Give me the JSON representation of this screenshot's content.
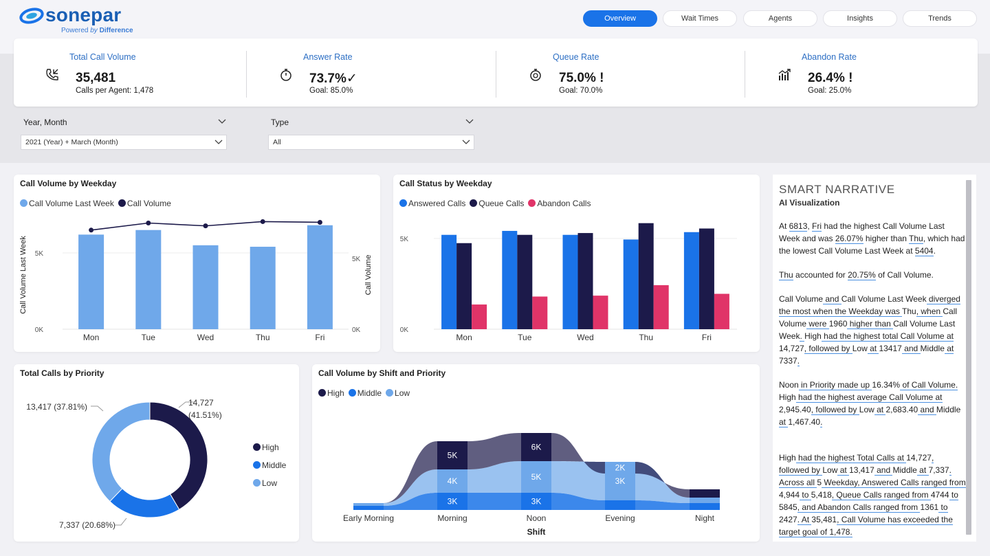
{
  "brand": {
    "name": "sonepar",
    "tagline_prefix": "Powered",
    "tagline_by": "by",
    "tagline_suffix": "Difference"
  },
  "nav": [
    "Overview",
    "Wait Times",
    "Agents",
    "Insights",
    "Trends"
  ],
  "kpis": [
    {
      "title": "Total Call Volume",
      "value": "35,481",
      "sub": "Calls per Agent: 1,478",
      "icon": "phone-incoming-icon"
    },
    {
      "title": "Answer Rate",
      "value": "73.7%✓",
      "sub": "Goal: 85.0%",
      "icon": "stopwatch-icon"
    },
    {
      "title": "Queue Rate",
      "value": "75.0% !",
      "sub": "Goal: 70.0%",
      "icon": "timer-icon"
    },
    {
      "title": "Abandon Rate",
      "value": "26.4% !",
      "sub": "Goal: 25.0%",
      "icon": "growth-chart-icon"
    }
  ],
  "filters": {
    "year_month": {
      "label": "Year, Month",
      "value": "2021 (Year) + March (Month)"
    },
    "type": {
      "label": "Type",
      "value": "All"
    }
  },
  "chart_titles": {
    "weekday": "Call Volume by Weekday",
    "status": "Call Status by Weekday",
    "priority": "Total Calls by Priority",
    "shift": "Call Volume by Shift and Priority"
  },
  "chart_data": [
    {
      "type": "bar",
      "title": "Call Volume by Weekday",
      "categories": [
        "Mon",
        "Tue",
        "Wed",
        "Thu",
        "Fri"
      ],
      "series": [
        {
          "name": "Call Volume Last Week",
          "kind": "bar",
          "values": [
            6200,
            6500,
            5500,
            5404,
            6813
          ]
        },
        {
          "name": "Call Volume",
          "kind": "line",
          "values": [
            7000,
            7500,
            7300,
            7600,
            7550
          ]
        }
      ],
      "ylabel": "Call Volume Last Week",
      "y2label": "Call Volume",
      "yticks": [
        "0K",
        "5K"
      ],
      "y2ticks": [
        "0K",
        "5K"
      ],
      "colors": [
        "#6fa8ea",
        "#1c1a4a"
      ]
    },
    {
      "type": "bar",
      "title": "Call Status by Weekday",
      "categories": [
        "Mon",
        "Tue",
        "Wed",
        "Thu",
        "Fri"
      ],
      "series": [
        {
          "name": "Answered Calls",
          "values": [
            5200,
            5418,
            5200,
            4944,
            5350
          ]
        },
        {
          "name": "Queue Calls",
          "values": [
            4744,
            5200,
            5300,
            5845,
            5550
          ]
        },
        {
          "name": "Abandon Calls",
          "values": [
            1361,
            1800,
            1850,
            2427,
            1950
          ]
        }
      ],
      "yticks": [
        "0K",
        "5K"
      ],
      "colors": [
        "#1a73e8",
        "#1c1a4a",
        "#e03468"
      ]
    },
    {
      "type": "pie",
      "title": "Total Calls by Priority",
      "categories": [
        "High",
        "Middle",
        "Low"
      ],
      "values": [
        14727,
        7337,
        13417
      ],
      "labels": [
        "14,727",
        "7,337 (20.68%)",
        "13,417 (37.81%)"
      ],
      "label_pct_high": "(41.51%)",
      "colors": [
        "#1c1a4a",
        "#1a73e8",
        "#6fa8ea"
      ]
    },
    {
      "type": "area",
      "title": "Call Volume by Shift and Priority",
      "categories": [
        "Early Morning",
        "Morning",
        "Noon",
        "Evening",
        "Night"
      ],
      "xlabel": "Shift",
      "series": [
        {
          "name": "High",
          "labels": [
            "",
            "5K",
            "6K",
            "2K",
            ""
          ]
        },
        {
          "name": "Middle",
          "labels": [
            "",
            "3K",
            "3K",
            "",
            ""
          ]
        },
        {
          "name": "Low",
          "labels": [
            "",
            "4K",
            "5K",
            "3K",
            ""
          ]
        }
      ],
      "colors": [
        "#1c1a4a",
        "#1a73e8",
        "#6fa8ea"
      ]
    }
  ],
  "narrative": {
    "title": "SMART NARRATIVE",
    "subtitle": "AI Visualization",
    "p1": [
      "At ",
      "6813",
      ", ",
      "Fri",
      " had the highest Call Volume Last Week and was ",
      "26.07%",
      " higher than ",
      "Thu",
      ", which had the lowest Call Volume Last Week at ",
      "5404",
      "."
    ],
    "p2": [
      " ",
      "Thu",
      " accounted for ",
      "20.75%",
      " of Call Volume."
    ],
    "p3": [
      "Call Volume",
      " and ",
      "Call Volume Last Week",
      " diverged the most when the Weekday was ",
      "Thu",
      ", when ",
      "Call Volume",
      " were ",
      "1960",
      " higher than ",
      "Call Volume Last Week",
      ". ",
      "High",
      " had the highest total Call Volume at ",
      "14,727",
      ", followed by ",
      "Low",
      " at ",
      "13417",
      " and ",
      "Middle",
      " at ",
      "7337",
      "."
    ],
    "p4": [
      "Noon",
      " in Priority  made up ",
      "16.34%",
      " of Call Volume. ",
      "High",
      " had the highest average Call Volume at ",
      "2,945.40",
      ", followed by ",
      "Low",
      " at ",
      "2,683.40",
      " and ",
      "Middle",
      " at ",
      "1,467.40",
      "."
    ],
    "p5": [
      "High",
      " had the highest Total Calls at ",
      "14,727",
      ", followed by ",
      "Low",
      " at ",
      "13,417",
      " and ",
      "Middle",
      " at ",
      "7,337",
      ". Across all ",
      "5",
      " Weekday, Answered Calls ranged from ",
      "4,944",
      " to ",
      "5,418",
      ", Queue Calls ranged from ",
      "4744",
      " to ",
      "5845",
      ", and Abandon Calls ranged from ",
      "1361",
      " to ",
      "2427",
      ". At ",
      "35,481",
      ", Call Volume has exceeded the target goal of 1,478."
    ]
  }
}
